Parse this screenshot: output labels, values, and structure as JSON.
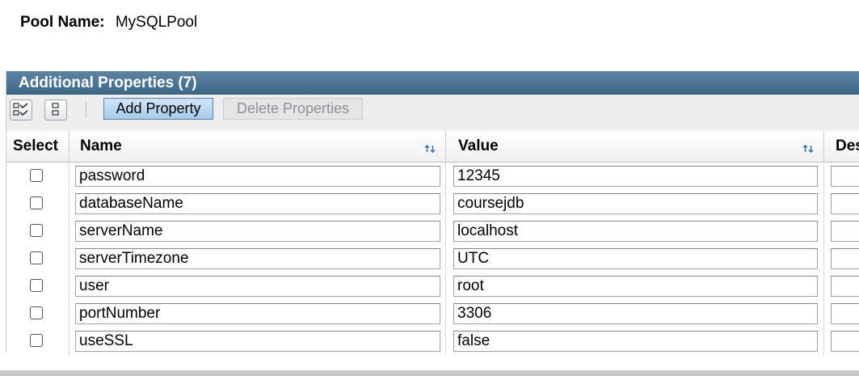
{
  "pool": {
    "label": "Pool Name:",
    "value": "MySQLPool"
  },
  "panel": {
    "title": "Additional Properties (7)",
    "toolbar": {
      "select_all_icon": "select-all-icon",
      "deselect_all_icon": "deselect-all-icon",
      "add_label": "Add Property",
      "delete_label": "Delete Properties"
    },
    "columns": {
      "select": "Select",
      "name": "Name",
      "value": "Value",
      "description": "Des"
    },
    "rows": [
      {
        "name": "password",
        "value": "12345"
      },
      {
        "name": "databaseName",
        "value": "coursejdb"
      },
      {
        "name": "serverName",
        "value": "localhost"
      },
      {
        "name": "serverTimezone",
        "value": "UTC"
      },
      {
        "name": "user",
        "value": "root"
      },
      {
        "name": "portNumber",
        "value": "3306"
      },
      {
        "name": "useSSL",
        "value": "false"
      }
    ]
  },
  "colors": {
    "title_bar": "#4a7495",
    "add_button": "#b7d6f0",
    "sort_icon": "#3b6fa0"
  }
}
